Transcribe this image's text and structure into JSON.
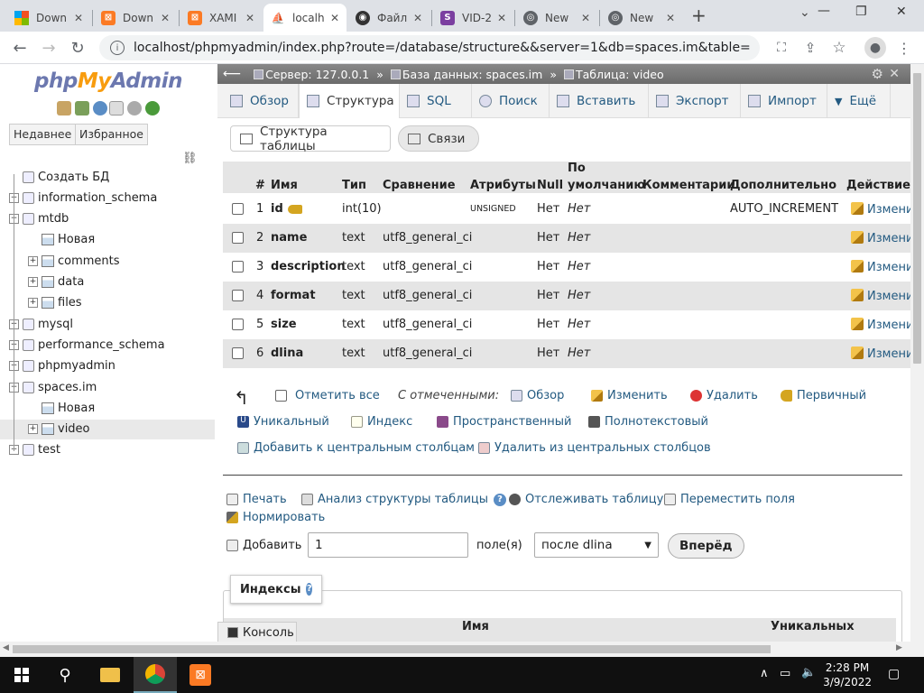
{
  "browser": {
    "tabs": [
      {
        "title": "Down",
        "icon": "microsoft-icon"
      },
      {
        "title": "Down",
        "icon": "xampp-icon"
      },
      {
        "title": "XAMI",
        "icon": "xampp-icon"
      },
      {
        "title": "localh",
        "icon": "phpmyadmin-icon",
        "active": true
      },
      {
        "title": "Файл",
        "icon": "file-icon"
      },
      {
        "title": "VID-2",
        "icon": "s-icon"
      },
      {
        "title": "New",
        "icon": "chrome-icon"
      },
      {
        "title": "New",
        "icon": "chrome-icon"
      }
    ],
    "new_tab": "+",
    "window_controls": [
      "⌄",
      "—",
      "❐",
      "✕"
    ],
    "url": "localhost/phpmyadmin/index.php?route=/database/structure&&server=1&db=spaces.im&table="
  },
  "nav": {
    "logo": {
      "php": "php",
      "my": "My",
      "admin": "Admin"
    },
    "tabs": [
      "Недавнее",
      "Избранное"
    ],
    "tree": [
      {
        "label": "Создать БД",
        "level": 0,
        "exp": ""
      },
      {
        "label": "information_schema",
        "level": 0,
        "exp": "+"
      },
      {
        "label": "mtdb",
        "level": 0,
        "exp": "−"
      },
      {
        "label": "Новая",
        "level": 1,
        "exp": ""
      },
      {
        "label": "comments",
        "level": 1,
        "exp": "+"
      },
      {
        "label": "data",
        "level": 1,
        "exp": "+"
      },
      {
        "label": "files",
        "level": 1,
        "exp": "+"
      },
      {
        "label": "mysql",
        "level": 0,
        "exp": "+"
      },
      {
        "label": "performance_schema",
        "level": 0,
        "exp": "+"
      },
      {
        "label": "phpmyadmin",
        "level": 0,
        "exp": "+"
      },
      {
        "label": "spaces.im",
        "level": 0,
        "exp": "−"
      },
      {
        "label": "Новая",
        "level": 1,
        "exp": ""
      },
      {
        "label": "video",
        "level": 1,
        "exp": "+",
        "selected": true
      },
      {
        "label": "test",
        "level": 0,
        "exp": "+"
      }
    ]
  },
  "breadcrumb": {
    "server": "Сервер: 127.0.0.1",
    "database": "База данных: spaces.im",
    "table": "Таблица: video",
    "sep": "»"
  },
  "main_tabs": [
    "Обзор",
    "Структура",
    "SQL",
    "Поиск",
    "Вставить",
    "Экспорт",
    "Импорт",
    "Ещё"
  ],
  "sub_tabs": [
    "Структура таблицы",
    "Связи"
  ],
  "columns": {
    "num": "#",
    "name": "Имя",
    "type": "Тип",
    "collation": "Сравнение",
    "attributes": "Атрибуты",
    "null": "Null",
    "default_l1": "По",
    "default_l2": "умолчанию",
    "comments": "Комментарии",
    "extra": "Дополнительно",
    "action": "Действие"
  },
  "rows": [
    {
      "n": "1",
      "name": "id",
      "type": "int(10)",
      "collation": "",
      "attr": "UNSIGNED",
      "null": "Нет",
      "default": "Нет",
      "extra": "AUTO_INCREMENT",
      "action": "Измени"
    },
    {
      "n": "2",
      "name": "name",
      "type": "text",
      "collation": "utf8_general_ci",
      "attr": "",
      "null": "Нет",
      "default": "Нет",
      "extra": "",
      "action": "Измени"
    },
    {
      "n": "3",
      "name": "description",
      "type": "text",
      "collation": "utf8_general_ci",
      "attr": "",
      "null": "Нет",
      "default": "Нет",
      "extra": "",
      "action": "Измени"
    },
    {
      "n": "4",
      "name": "format",
      "type": "text",
      "collation": "utf8_general_ci",
      "attr": "",
      "null": "Нет",
      "default": "Нет",
      "extra": "",
      "action": "Измени"
    },
    {
      "n": "5",
      "name": "size",
      "type": "text",
      "collation": "utf8_general_ci",
      "attr": "",
      "null": "Нет",
      "default": "Нет",
      "extra": "",
      "action": "Измени"
    },
    {
      "n": "6",
      "name": "dlina",
      "type": "text",
      "collation": "utf8_general_ci",
      "attr": "",
      "null": "Нет",
      "default": "Нет",
      "extra": "",
      "action": "Измени"
    }
  ],
  "bulk": {
    "check_all": "Отметить все",
    "with_selected": "С отмеченными:",
    "browse": "Обзор",
    "change": "Изменить",
    "drop": "Удалить",
    "primary": "Первичный",
    "unique": "Уникальный",
    "index": "Индекс",
    "spatial": "Пространственный",
    "fulltext": "Полнотекстовый",
    "add_central": "Добавить к центральным столбцам",
    "remove_central": "Удалить из центральных столбцов"
  },
  "tools": {
    "print": "Печать",
    "analyze": "Анализ структуры таблицы",
    "track": "Отслеживать таблицу",
    "move": "Переместить поля",
    "normalize": "Нормировать"
  },
  "add_fields": {
    "label": "Добавить",
    "count": "1",
    "fields_label": "поле(я)",
    "position": "после dlina",
    "go": "Вперёд"
  },
  "indexes": {
    "title": "Индексы",
    "col_name": "Имя",
    "col_unique": "Уникальных"
  },
  "console": "Консоль",
  "taskbar": {
    "time": "2:28 PM",
    "date": "3/9/2022"
  },
  "colors": {
    "link": "#235a81",
    "pma_blue": "#6c78af",
    "pma_orange": "#f89c0e",
    "row_alt": "#e5e5e5"
  }
}
